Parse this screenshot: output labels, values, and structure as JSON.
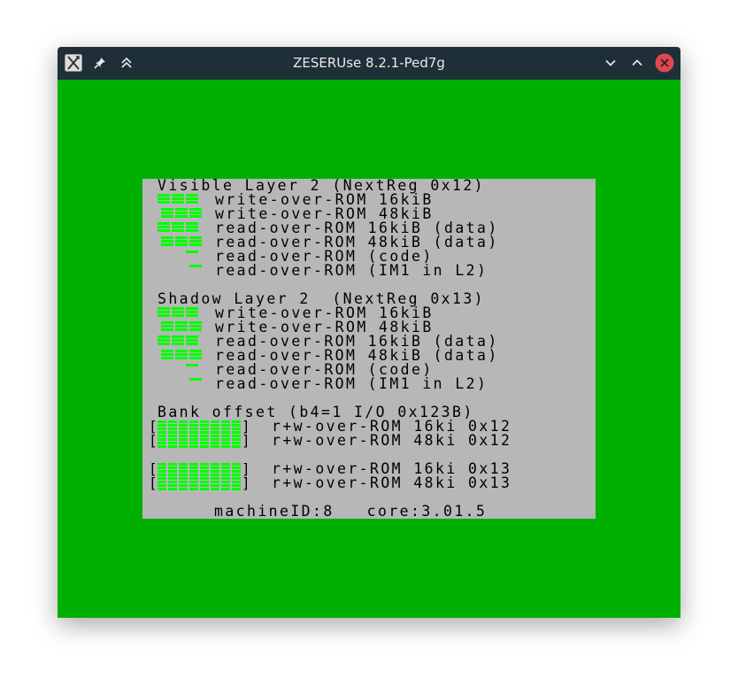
{
  "window": {
    "title": "ZESERUse 8.2.1-Ped7g"
  },
  "screen": {
    "visible_heading": "Visible Layer 2 (NextReg 0x12)",
    "visible_lines": [
      "write-over-ROM 16kiB",
      "write-over-ROM 48kiB",
      "read-over-ROM 16kiB (data)",
      "read-over-ROM 48kiB (data)",
      "read-over-ROM (code)",
      "read-over-ROM (IM1 in L2)"
    ],
    "shadow_heading": "Shadow Layer 2  (NextReg 0x13)",
    "shadow_lines": [
      "write-over-ROM 16kiB",
      "write-over-ROM 48kiB",
      "read-over-ROM 16kiB (data)",
      "read-over-ROM 48kiB (data)",
      "read-over-ROM (code)",
      "read-over-ROM (IM1 in L2)"
    ],
    "bank_heading": "Bank offset (b4=1 I/O 0x123B)",
    "bank_lines": [
      "r+w-over-ROM 16ki 0x12",
      "r+w-over-ROM 48ki 0x12",
      "r+w-over-ROM 16ki 0x13",
      "r+w-over-ROM 48ki 0x13"
    ],
    "bracket_open": "[",
    "bracket_close": "]",
    "footer": "machineID:8   core:3.01.5"
  },
  "colors": {
    "titlebar": "#1f2f38",
    "border_green": "#00b000",
    "paper": "#b7b7b7",
    "indicator_green": "#00ff00",
    "close_red": "#e0474f"
  },
  "icons": {
    "app": "zeserus-app-icon",
    "pin": "pin-icon",
    "keep_above": "keep-above-icon",
    "minimize": "chevron-down-icon",
    "maximize": "chevron-up-icon",
    "close": "close-icon"
  }
}
